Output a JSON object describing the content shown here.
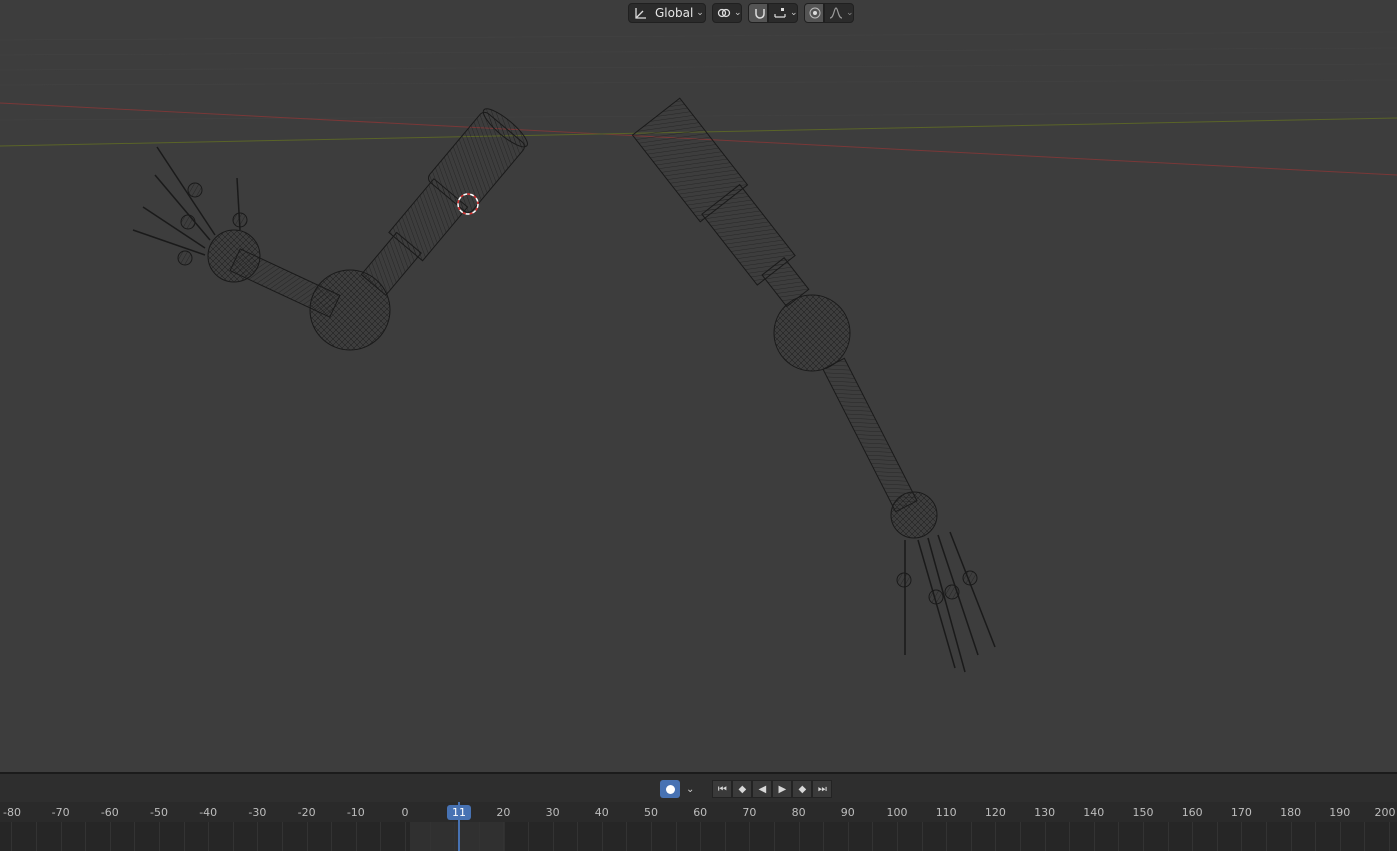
{
  "toolbar": {
    "transform_orientation": "Global",
    "icons": [
      "transform-orientation-icon",
      "pivot-link-icon",
      "snap-magnet-icon",
      "snap-target-icon",
      "proportional-edit-icon",
      "falloff-curve-icon"
    ]
  },
  "timeline": {
    "current_frame": "11",
    "ruler_labels": [
      "-80",
      "-70",
      "-60",
      "-50",
      "-40",
      "-30",
      "-20",
      "-10",
      "0",
      "20",
      "30",
      "40",
      "50",
      "60",
      "70",
      "80",
      "90",
      "100",
      "110",
      "120",
      "130",
      "140",
      "150",
      "160",
      "170",
      "180",
      "190",
      "200"
    ],
    "playback_icons": [
      "jump-start-icon",
      "prev-keyframe-icon",
      "play-reverse-icon",
      "play-icon",
      "next-keyframe-icon",
      "jump-end-icon"
    ]
  },
  "colors": {
    "viewport_bg": "#3d3d3d",
    "accent": "#4772b3",
    "x_axis": "#8a3a3a",
    "y_axis": "#5f6b2a",
    "wire": "#1a1a1a"
  }
}
